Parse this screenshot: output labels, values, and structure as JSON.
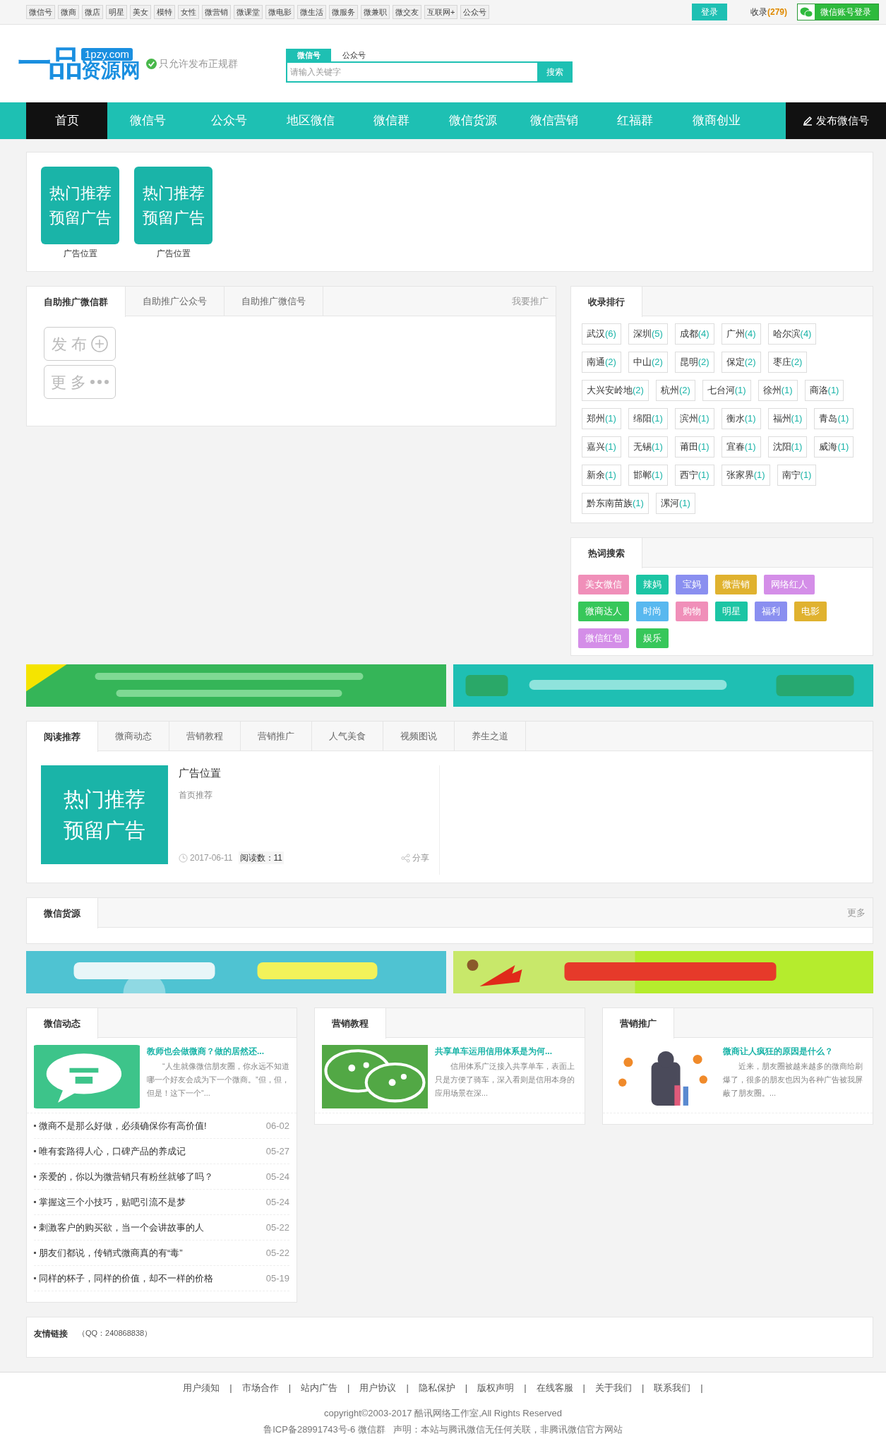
{
  "topbar": {
    "tags": [
      "微信号",
      "微商",
      "微店",
      "明星",
      "美女",
      "模特",
      "女性",
      "微营销",
      "微课堂",
      "微电影",
      "微生活",
      "微服务",
      "微兼职",
      "微交友",
      "互联网+",
      "公众号"
    ],
    "login": "登录",
    "count_label": "收录",
    "count": "(279)",
    "wechat_login": "微信账号登录"
  },
  "header": {
    "logo": {
      "mark": "一品",
      "domain": "1pzy.com",
      "name": "资源网"
    },
    "verified": "只允许发布正规群",
    "search": {
      "tabs": [
        {
          "label": "微信号",
          "selected": true
        },
        {
          "label": "公众号",
          "selected": false
        }
      ],
      "placeholder": "请输入关键字",
      "button": "搜索"
    }
  },
  "nav": {
    "items": [
      {
        "label": "首页",
        "selected": true
      },
      {
        "label": "微信号",
        "selected": false
      },
      {
        "label": "公众号",
        "selected": false
      },
      {
        "label": "地区微信",
        "selected": false
      },
      {
        "label": "微信群",
        "selected": false
      },
      {
        "label": "微信货源",
        "selected": false
      },
      {
        "label": "微信营销",
        "selected": false
      },
      {
        "label": "红福群",
        "selected": false
      },
      {
        "label": "微商创业",
        "selected": false
      }
    ],
    "publish": "发布微信号"
  },
  "ads": [
    {
      "lines": [
        "热门推荐",
        "预留广告"
      ],
      "caption": "广告位置"
    },
    {
      "lines": [
        "热门推荐",
        "预留广告"
      ],
      "caption": "广告位置"
    }
  ],
  "promo": {
    "tabs": [
      {
        "label": "自助推广微信群",
        "selected": true
      },
      {
        "label": "自助推广公众号",
        "selected": false
      },
      {
        "label": "自助推广微信号",
        "selected": false
      }
    ],
    "extra": "我要推广",
    "buttons": [
      {
        "label": "发 布",
        "kind": "plus"
      },
      {
        "label": "更 多",
        "kind": "more"
      }
    ]
  },
  "ranking": {
    "title": "收录排行",
    "items": [
      {
        "city": "武汉",
        "count": "(6)"
      },
      {
        "city": "深圳",
        "count": "(5)"
      },
      {
        "city": "成都",
        "count": "(4)"
      },
      {
        "city": "广州",
        "count": "(4)"
      },
      {
        "city": "哈尔滨",
        "count": "(4)"
      },
      {
        "city": "南通",
        "count": "(2)"
      },
      {
        "city": "中山",
        "count": "(2)"
      },
      {
        "city": "昆明",
        "count": "(2)"
      },
      {
        "city": "保定",
        "count": "(2)"
      },
      {
        "city": "枣庄",
        "count": "(2)"
      },
      {
        "city": "大兴安岭地",
        "count": "(2)"
      },
      {
        "city": "杭州",
        "count": "(2)"
      },
      {
        "city": "七台河",
        "count": "(1)"
      },
      {
        "city": "徐州",
        "count": "(1)"
      },
      {
        "city": "商洛",
        "count": "(1)"
      },
      {
        "city": "郑州",
        "count": "(1)"
      },
      {
        "city": "绵阳",
        "count": "(1)"
      },
      {
        "city": "滨州",
        "count": "(1)"
      },
      {
        "city": "衡水",
        "count": "(1)"
      },
      {
        "city": "福州",
        "count": "(1)"
      },
      {
        "city": "青岛",
        "count": "(1)"
      },
      {
        "city": "嘉兴",
        "count": "(1)"
      },
      {
        "city": "无锡",
        "count": "(1)"
      },
      {
        "city": "莆田",
        "count": "(1)"
      },
      {
        "city": "宜春",
        "count": "(1)"
      },
      {
        "city": "沈阳",
        "count": "(1)"
      },
      {
        "city": "威海",
        "count": "(1)"
      },
      {
        "city": "新余",
        "count": "(1)"
      },
      {
        "city": "邯郸",
        "count": "(1)"
      },
      {
        "city": "西宁",
        "count": "(1)"
      },
      {
        "city": "张家界",
        "count": "(1)"
      },
      {
        "city": "南宁",
        "count": "(1)"
      },
      {
        "city": "黔东南苗族",
        "count": "(1)"
      },
      {
        "city": "漯河",
        "count": "(1)"
      }
    ]
  },
  "hot": {
    "title": "热词搜索",
    "tags": [
      {
        "label": "美女微信",
        "color": "#f08fb9"
      },
      {
        "label": "辣妈",
        "color": "#1cc5a4"
      },
      {
        "label": "宝妈",
        "color": "#8a8ff0"
      },
      {
        "label": "微营销",
        "color": "#e0b22f"
      },
      {
        "label": "网络红人",
        "color": "#d48ee8"
      },
      {
        "label": "微商达人",
        "color": "#37c75a"
      },
      {
        "label": "时尚",
        "color": "#58b8ef"
      },
      {
        "label": "购物",
        "color": "#f08fb9"
      },
      {
        "label": "明星",
        "color": "#1cc5a4"
      },
      {
        "label": "福利",
        "color": "#8a8ff0"
      },
      {
        "label": "电影",
        "color": "#e0b22f"
      },
      {
        "label": "微信红包",
        "color": "#d48ee8"
      },
      {
        "label": "娱乐",
        "color": "#37c75a"
      }
    ]
  },
  "reading": {
    "tabs": [
      {
        "label": "阅读推荐",
        "selected": true
      },
      {
        "label": "微商动态",
        "selected": false
      },
      {
        "label": "营销教程",
        "selected": false
      },
      {
        "label": "营销推广",
        "selected": false
      },
      {
        "label": "人气美食",
        "selected": false
      },
      {
        "label": "视频图说",
        "selected": false
      },
      {
        "label": "养生之道",
        "selected": false
      }
    ],
    "article": {
      "ad_lines": [
        "热门推荐",
        "预留广告"
      ],
      "title": "广告位置",
      "tag": "首页推荐",
      "date": "2017-06-11",
      "reads": "阅读数：11",
      "share": "分享"
    }
  },
  "goods": {
    "title": "微信货源",
    "more": "更多"
  },
  "cards": [
    {
      "title": "微信动态",
      "headline": "教师也会做微商？做的居然还...",
      "summary": "“人生就像微信朋友圈，你永远不知道哪一个好友会成为下一个微商。”但，但，但是！这下一个“...",
      "list": [
        {
          "text": "微商不是那么好做，必须确保你有高价值!",
          "date": "06-02"
        },
        {
          "text": "唯有套路得人心，口碑产品的养成记",
          "date": "05-27"
        },
        {
          "text": "亲爱的，你以为微营销只有粉丝就够了吗？",
          "date": "05-24"
        },
        {
          "text": "掌握这三个小技巧，贴吧引流不是梦",
          "date": "05-24"
        },
        {
          "text": "刺激客户的购买欲，当一个会讲故事的人",
          "date": "05-22"
        },
        {
          "text": "朋友们都说，传销式微商真的有“毒”",
          "date": "05-22"
        },
        {
          "text": "同样的杯子，同样的价值，却不一样的价格",
          "date": "05-19"
        }
      ]
    },
    {
      "title": "营销教程",
      "headline": "共享单车运用信用体系是为何...",
      "summary": "信用体系广泛接入共享单车，表面上只是方便了骑车，深入看则是信用本身的应用场景在深..."
    },
    {
      "title": "营销推广",
      "headline": "微商让人疯狂的原因是什么？",
      "summary": "近来，朋友圈被越来越多的微商给刷爆了，很多的朋友也因为各种广告被我屏蔽了朋友圈。..."
    }
  ],
  "friends": {
    "title": "友情链接",
    "qq": "（QQ：240868838）"
  },
  "footer": {
    "links": [
      "用户须知",
      "市场合作",
      "站内广告",
      "用户协议",
      "隐私保护",
      "版权声明",
      "在线客服",
      "关于我们",
      "联系我们"
    ],
    "separator": "|",
    "copyright": "copyright©2003-2017 酷讯网络工作室,All Rights Reserved",
    "icp": "鲁ICP备28991743号-6 微信群   声明：本站与腾讯微信无任何关联，非腾讯微信官方网站"
  }
}
